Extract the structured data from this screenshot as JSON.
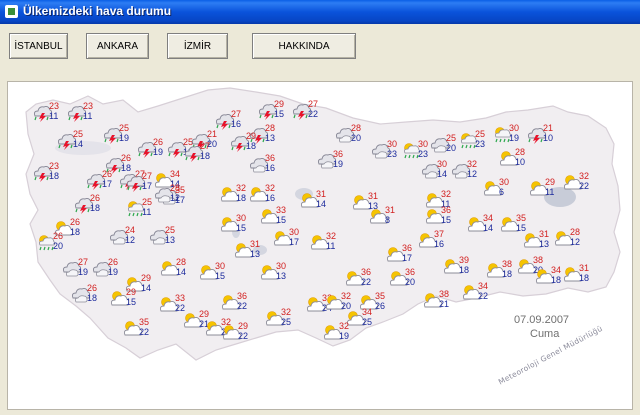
{
  "window": {
    "title": "Ülkemizdeki hava durumu"
  },
  "toolbar": {
    "buttons": [
      "İSTANBUL",
      "ANKARA",
      "İZMİR",
      "HAKKINDA"
    ]
  },
  "stamp": {
    "organization": "Meteoroloji Genel Müdürlüğü",
    "date": "07.09.2007",
    "day": "Cuma"
  },
  "colors": {
    "high": "#D22020",
    "low": "#1C2A9C",
    "land": "#F1EEF1",
    "lake": "#C8CCD8"
  },
  "cities": [
    {
      "hi": "23",
      "lo": "11",
      "icon": "storm"
    },
    {
      "hi": "23",
      "lo": "11",
      "icon": "storm"
    },
    {
      "hi": "25",
      "lo": "14",
      "icon": "storm"
    },
    {
      "hi": "25",
      "lo": "19",
      "icon": "storm"
    },
    {
      "hi": "26",
      "lo": "19",
      "icon": "storm"
    },
    {
      "hi": "25",
      "lo": "18",
      "icon": "storm"
    },
    {
      "hi": "21",
      "lo": "20",
      "icon": "storm"
    },
    {
      "hi": "27",
      "lo": "16",
      "icon": "storm"
    },
    {
      "hi": "29",
      "lo": "15",
      "icon": "storm"
    },
    {
      "hi": "27",
      "lo": "22",
      "icon": "storm"
    },
    {
      "hi": "28",
      "lo": "13",
      "icon": "storm"
    },
    {
      "hi": "27",
      "lo": "18",
      "icon": "storm"
    },
    {
      "hi": "29",
      "lo": "18",
      "icon": "storm"
    },
    {
      "hi": "28",
      "lo": "20",
      "icon": "cloud"
    },
    {
      "hi": "26",
      "lo": "18",
      "icon": "storm"
    },
    {
      "hi": "27",
      "lo": "15",
      "icon": "storm"
    },
    {
      "hi": "34",
      "lo": "14",
      "icon": "partly"
    },
    {
      "hi": "36",
      "lo": "16",
      "icon": "cloud"
    },
    {
      "hi": "36",
      "lo": "19",
      "icon": "cloud"
    },
    {
      "hi": "30",
      "lo": "23",
      "icon": "cloud"
    },
    {
      "hi": "30",
      "lo": "23",
      "icon": "rain"
    },
    {
      "hi": "25",
      "lo": "20",
      "icon": "cloud"
    },
    {
      "hi": "25",
      "lo": "23",
      "icon": "rain"
    },
    {
      "hi": "30",
      "lo": "19",
      "icon": "rain"
    },
    {
      "hi": "21",
      "lo": "10",
      "icon": "storm"
    },
    {
      "hi": "23",
      "lo": "18",
      "icon": "storm"
    },
    {
      "hi": "26",
      "lo": "17",
      "icon": "storm"
    },
    {
      "hi": "27",
      "lo": "17",
      "icon": "storm"
    },
    {
      "hi": "35",
      "lo": "17",
      "icon": "cloud"
    },
    {
      "hi": "30",
      "lo": "14",
      "icon": "cloud"
    },
    {
      "hi": "32",
      "lo": "12",
      "icon": "cloud"
    },
    {
      "hi": "28",
      "lo": "10",
      "icon": "partly"
    },
    {
      "hi": "26",
      "lo": "18",
      "icon": "storm"
    },
    {
      "hi": "28",
      "lo": "12",
      "icon": "cloud"
    },
    {
      "hi": "32",
      "lo": "18",
      "icon": "partly"
    },
    {
      "hi": "32",
      "lo": "16",
      "icon": "partly"
    },
    {
      "hi": "31",
      "lo": "14",
      "icon": "partly"
    },
    {
      "hi": "31",
      "lo": "13",
      "icon": "partly"
    },
    {
      "hi": "32",
      "lo": "11",
      "icon": "partly"
    },
    {
      "hi": "30",
      "lo": "6",
      "icon": "partly"
    },
    {
      "hi": "29",
      "lo": "11",
      "icon": "partly"
    },
    {
      "hi": "32",
      "lo": "22",
      "icon": "partly"
    },
    {
      "hi": "25",
      "lo": "11",
      "icon": "rain"
    },
    {
      "hi": "26",
      "lo": "18",
      "icon": "partly"
    },
    {
      "hi": "30",
      "lo": "15",
      "icon": "partly"
    },
    {
      "hi": "33",
      "lo": "15",
      "icon": "partly"
    },
    {
      "hi": "31",
      "lo": "8",
      "icon": "partly"
    },
    {
      "hi": "36",
      "lo": "15",
      "icon": "partly"
    },
    {
      "hi": "34",
      "lo": "14",
      "icon": "partly"
    },
    {
      "hi": "35",
      "lo": "15",
      "icon": "partly"
    },
    {
      "hi": "26",
      "lo": "20",
      "icon": "rain"
    },
    {
      "hi": "24",
      "lo": "12",
      "icon": "cloud"
    },
    {
      "hi": "25",
      "lo": "13",
      "icon": "cloud"
    },
    {
      "hi": "30",
      "lo": "17",
      "icon": "partly"
    },
    {
      "hi": "31",
      "lo": "13",
      "icon": "partly"
    },
    {
      "hi": "32",
      "lo": "11",
      "icon": "partly"
    },
    {
      "hi": "36",
      "lo": "17",
      "icon": "partly"
    },
    {
      "hi": "37",
      "lo": "16",
      "icon": "partly"
    },
    {
      "hi": "31",
      "lo": "13",
      "icon": "partly"
    },
    {
      "hi": "28",
      "lo": "12",
      "icon": "partly"
    },
    {
      "hi": "27",
      "lo": "19",
      "icon": "cloud"
    },
    {
      "hi": "26",
      "lo": "19",
      "icon": "cloud"
    },
    {
      "hi": "29",
      "lo": "14",
      "icon": "partly"
    },
    {
      "hi": "28",
      "lo": "14",
      "icon": "partly"
    },
    {
      "hi": "30",
      "lo": "15",
      "icon": "partly"
    },
    {
      "hi": "30",
      "lo": "13",
      "icon": "partly"
    },
    {
      "hi": "36",
      "lo": "22",
      "icon": "partly"
    },
    {
      "hi": "36",
      "lo": "20",
      "icon": "partly"
    },
    {
      "hi": "39",
      "lo": "18",
      "icon": "partly"
    },
    {
      "hi": "38",
      "lo": "18",
      "icon": "partly"
    },
    {
      "hi": "38",
      "lo": "20",
      "icon": "partly"
    },
    {
      "hi": "34",
      "lo": "18",
      "icon": "partly"
    },
    {
      "hi": "31",
      "lo": "18",
      "icon": "partly"
    },
    {
      "hi": "26",
      "lo": "18",
      "icon": "cloud"
    },
    {
      "hi": "29",
      "lo": "15",
      "icon": "partly"
    },
    {
      "hi": "33",
      "lo": "22",
      "icon": "partly"
    },
    {
      "hi": "36",
      "lo": "22",
      "icon": "partly"
    },
    {
      "hi": "35",
      "lo": "26",
      "icon": "partly"
    },
    {
      "hi": "38",
      "lo": "21",
      "icon": "partly"
    },
    {
      "hi": "34",
      "lo": "22",
      "icon": "partly"
    },
    {
      "hi": "35",
      "lo": "22",
      "icon": "partly"
    },
    {
      "hi": "29",
      "lo": "21",
      "icon": "partly"
    },
    {
      "hi": "32",
      "lo": "21",
      "icon": "partly"
    },
    {
      "hi": "32",
      "lo": "25",
      "icon": "partly"
    },
    {
      "hi": "32",
      "lo": "24",
      "icon": "partly"
    },
    {
      "hi": "32",
      "lo": "20",
      "icon": "partly"
    },
    {
      "hi": "34",
      "lo": "25",
      "icon": "partly"
    },
    {
      "hi": "29",
      "lo": "22",
      "icon": "partly"
    },
    {
      "hi": "32",
      "lo": "19",
      "icon": "partly"
    }
  ]
}
